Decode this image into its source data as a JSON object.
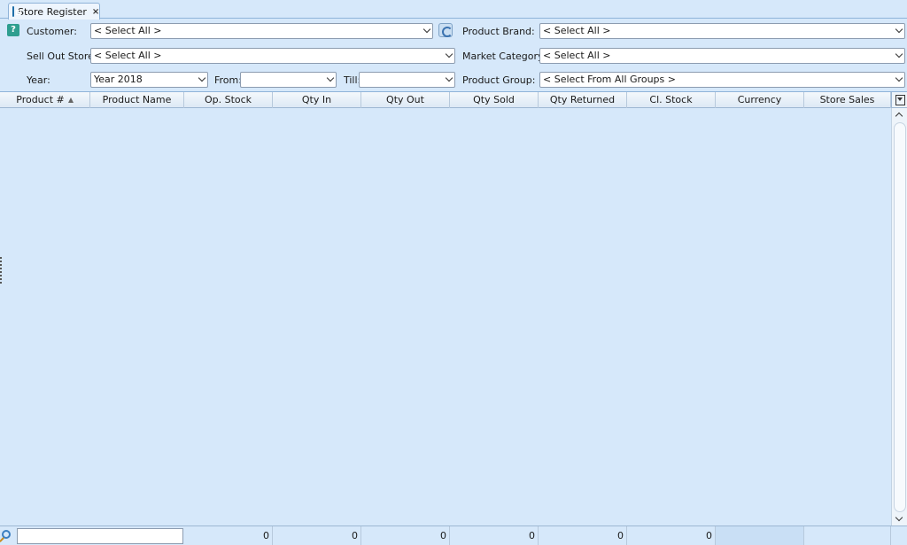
{
  "tab": {
    "label": "Store Register",
    "close": "×"
  },
  "filters": {
    "help": "?",
    "customer": {
      "label": "Customer:",
      "value": "< Select All >"
    },
    "sell_out_store": {
      "label": "Sell Out Store:",
      "value": "< Select All >"
    },
    "year": {
      "label": "Year:",
      "value": "Year 2018"
    },
    "from": {
      "label": "From:",
      "value": ""
    },
    "till": {
      "label": "Till:",
      "value": ""
    },
    "product_brand": {
      "label": "Product Brand:",
      "value": "< Select All >"
    },
    "market_category": {
      "label": "Market Category:",
      "value": "< Select All >"
    },
    "product_group": {
      "label": "Product Group:",
      "value": "< Select From All Groups >"
    }
  },
  "grid": {
    "columns": [
      "Product #",
      "Product Name",
      "Op. Stock",
      "Qty In",
      "Qty Out",
      "Qty Sold",
      "Qty Returned",
      "Cl. Stock",
      "Currency",
      "Store Sales"
    ],
    "sorted_column": "Product #"
  },
  "footer": {
    "search_value": "",
    "totals": [
      "0",
      "0",
      "0",
      "0",
      "0",
      "0",
      "",
      ""
    ]
  }
}
